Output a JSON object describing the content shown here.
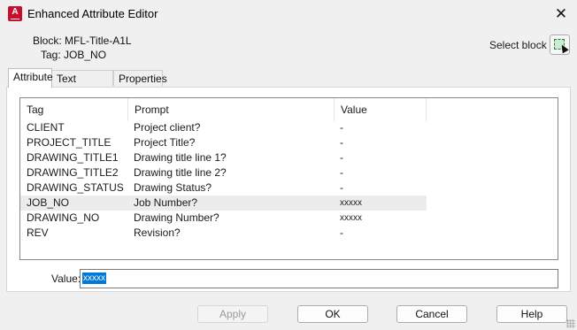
{
  "window": {
    "title": "Enhanced Attribute Editor",
    "app_icon_letter": "A"
  },
  "info": {
    "block_label": "Block:",
    "block_value": "MFL-Title-A1L",
    "tag_label": "Tag:",
    "tag_value": "JOB_NO",
    "select_block_label": "Select block"
  },
  "tabs": [
    {
      "label": "Attribute",
      "active": true
    },
    {
      "label": "Text Options",
      "active": false
    },
    {
      "label": "Properties",
      "active": false
    }
  ],
  "table": {
    "headers": [
      "Tag",
      "Prompt",
      "Value"
    ],
    "rows": [
      {
        "tag": "CLIENT",
        "prompt": "Project client?",
        "value": "-"
      },
      {
        "tag": "PROJECT_TITLE",
        "prompt": "Project Title?",
        "value": "-"
      },
      {
        "tag": "DRAWING_TITLE1",
        "prompt": "Drawing title line 1?",
        "value": "-"
      },
      {
        "tag": "DRAWING_TITLE2",
        "prompt": "Drawing title line 2?",
        "value": "-"
      },
      {
        "tag": "DRAWING_STATUS",
        "prompt": "Drawing Status?",
        "value": "-"
      },
      {
        "tag": "JOB_NO",
        "prompt": "Job Number?",
        "value": "xxxxx"
      },
      {
        "tag": "DRAWING_NO",
        "prompt": "Drawing Number?",
        "value": "xxxxx"
      },
      {
        "tag": "REV",
        "prompt": "Revision?",
        "value": "-"
      }
    ],
    "selected_index": 5
  },
  "value_field": {
    "label": "Value:",
    "value": "xxxxx"
  },
  "buttons": {
    "apply": "Apply",
    "ok": "OK",
    "cancel": "Cancel",
    "help": "Help"
  },
  "icons": {
    "close": "close-icon",
    "select_block": "select-block-icon"
  }
}
